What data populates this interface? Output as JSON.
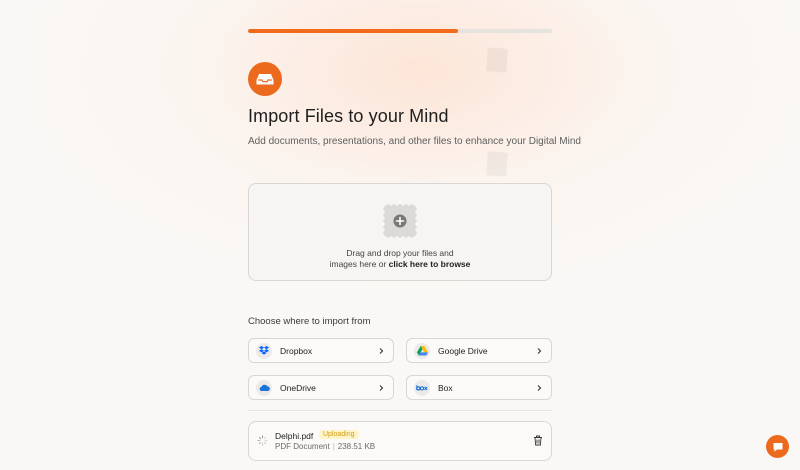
{
  "progress": {
    "fraction": 0.69
  },
  "header": {
    "brand_icon": "inbox-tray-icon",
    "title": "Import Files to your Mind",
    "subtitle": "Add documents, presentations, and other files to enhance your Digital Mind"
  },
  "dropzone": {
    "icon": "add-file-icon",
    "line1": "Drag and drop your files and",
    "line2_prefix": "images here or ",
    "browse_label": "click here to browse"
  },
  "sources": {
    "heading": "Choose where to import from",
    "items": [
      {
        "label": "Dropbox",
        "icon": "dropbox-icon"
      },
      {
        "label": "Google Drive",
        "icon": "google-drive-icon"
      },
      {
        "label": "OneDrive",
        "icon": "onedrive-icon"
      },
      {
        "label": "Box",
        "icon": "box-icon"
      }
    ]
  },
  "files": [
    {
      "name": "Delphi.pdf",
      "status": "Uploading",
      "type": "PDF Document",
      "size": "238.51 KB"
    }
  ],
  "colors": {
    "accent": "#ec6a1d",
    "progress": "#f26a1b",
    "badge_text": "#d4a017",
    "badge_bg": "#fdf4c8"
  }
}
